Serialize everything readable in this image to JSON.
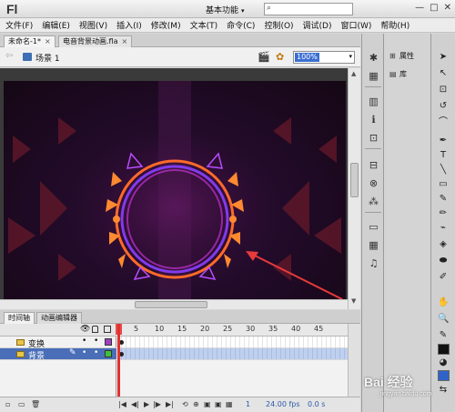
{
  "app": {
    "logo": "Fl"
  },
  "titlebar": {
    "workspace": "基本功能",
    "workspace_arrow": "▾",
    "search_icon": "⌕",
    "minimize": "—",
    "maximize": "□",
    "close": "✕"
  },
  "menu": [
    "文件(F)",
    "编辑(E)",
    "视图(V)",
    "插入(I)",
    "修改(M)",
    "文本(T)",
    "命令(C)",
    "控制(O)",
    "调试(D)",
    "窗口(W)",
    "帮助(H)"
  ],
  "doc_tabs": [
    {
      "label": "未命名-1*",
      "close": "×"
    },
    {
      "label": "电音背景动画.fla",
      "close": "×"
    }
  ],
  "scene": {
    "back": "⇦",
    "label": "场景 1",
    "edit_scene_icon": "🎬",
    "edit_symbol_icon": "✿",
    "zoom": "100%",
    "zoom_arrow": "▾"
  },
  "scrollbar": {
    "up": "▲",
    "down": "▼"
  },
  "timeline_tabs": [
    "时间轴",
    "动画编辑器"
  ],
  "timeline": {
    "header_eye": "👁",
    "layers": [
      {
        "name": "变换",
        "d1": "•",
        "d2": "•",
        "color": "#a040c0",
        "selected": false
      },
      {
        "name": "背景",
        "pencil": "✎",
        "d1": "•",
        "d2": "•",
        "color": "#40c040",
        "selected": true
      }
    ],
    "ruler": [
      "1",
      "5",
      "10",
      "15",
      "20",
      "25",
      "30",
      "35",
      "40",
      "45"
    ],
    "bottom": {
      "new_layer": "▫",
      "folder": "▭",
      "delete": "🗑",
      "first": "|◀",
      "prev": "◀|",
      "play": "▶",
      "next": "|▶",
      "last": "▶|",
      "loop": "⟲",
      "center": "⊕",
      "onion": "▣",
      "onion2": "▣",
      "edit_multi": "▦",
      "frame": "1",
      "fps": "24.00 fps",
      "time": "0.0 s"
    }
  },
  "props_panel": [
    {
      "icon": "⊞",
      "label": "属性"
    },
    {
      "icon": "▤",
      "label": "库"
    }
  ],
  "mid_panel_icons": [
    "✱",
    "▦",
    "▥",
    "ℹ",
    "⊡",
    "⊟",
    "⊗",
    "⁂",
    "▭",
    "▦",
    "♫"
  ],
  "tools": [
    "➤",
    "↖",
    "⊡",
    "↺",
    "⌒",
    "✒",
    "T",
    "╲",
    "▭",
    "✎",
    "✏",
    "⌁",
    "◈",
    "⬬",
    "✐",
    "✋",
    "🔍",
    "✎",
    "◕",
    "⇆"
  ],
  "colors": {
    "stroke": "#111111",
    "fill": "#2f63c9",
    "playhead": "#e23030",
    "selected_layer": "#4a6fb8"
  },
  "watermark": {
    "main": "Bai 经验",
    "sub": "jingyan.baidu.com"
  }
}
